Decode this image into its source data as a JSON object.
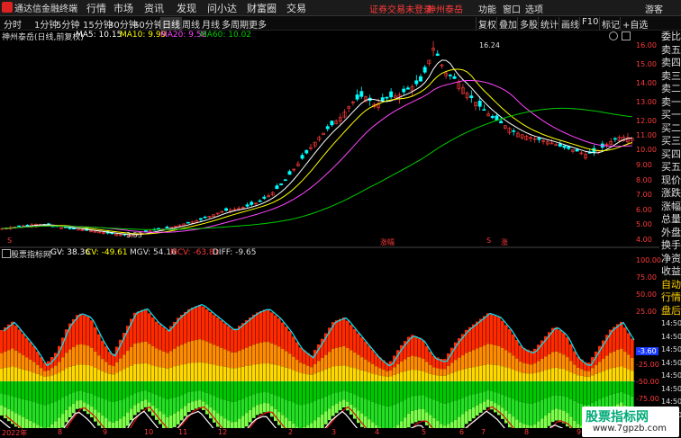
{
  "menubar": {
    "app_name": "通达信金融终端",
    "items": [
      "行情",
      "市场",
      "资讯",
      "发现",
      "问小达",
      "财富圈",
      "交易"
    ],
    "warning": "证券交易未登录",
    "stock": "神州泰岳",
    "right": [
      "功能",
      "窗口",
      "选项",
      "游客"
    ]
  },
  "toolbar": {
    "periods": [
      "分时",
      "1分钟",
      "5分钟",
      "15分钟",
      "30分钟",
      "60分钟",
      "日线",
      "周线",
      "月线",
      "多周期",
      "更多"
    ],
    "active_period": "日线",
    "tools": [
      "复权",
      "叠加",
      "多股",
      "统计",
      "画线",
      "F10",
      "标记",
      "+自选"
    ]
  },
  "infobar": {
    "title": "神州泰岳(日线,前复权)",
    "ma5": "MA5: 10.15",
    "ma10": "MA10: 9.99",
    "ma20": "MA20: 9.58",
    "ma60": "MA60: 10.02"
  },
  "colors": {
    "ma5": "#ffffff",
    "ma10": "#ffff00",
    "ma20": "#ff44ff",
    "ma60": "#00cc00",
    "up": "#ff3b3b",
    "down": "#00ffff",
    "accent": "#ff3b3b"
  },
  "right_panel": [
    "委比",
    "卖五",
    "卖四",
    "卖三",
    "卖二",
    "卖一",
    "买一",
    "买二",
    "买三",
    "买四",
    "买五",
    "现价",
    "涨跌",
    "涨幅",
    "总量",
    "外盘",
    "换手",
    "净资",
    "收益",
    "自动",
    "行情",
    "盘后",
    "14:50",
    "14:50",
    "14:50",
    "14:50",
    "14:50",
    "14:50",
    "14:50",
    "14:50"
  ],
  "price_axis": [
    "16.00",
    "15.00",
    "14.00",
    "13.00",
    "12.00",
    "11.00",
    "10.00",
    "9.00",
    "8.00",
    "7.00",
    "6.00",
    "5.00",
    "4.00"
  ],
  "annotations": {
    "high": "16.24",
    "low": "3.53",
    "event1": "涨幅",
    "event2": "涨"
  },
  "markers": {
    "left": "S",
    "mid": "S"
  },
  "indicator": {
    "name": "股票指标网",
    "gv": "GV: 38.36",
    "cv": "CV: -49.61",
    "mgv": "MGV: 54.16",
    "mcv": "MCV: -63.81",
    "diff": "DIFF: -9.65",
    "axis": [
      "100.00",
      "75.00",
      "50.00",
      "25.00",
      "-25.00",
      "-50.00",
      "-75.00"
    ],
    "current": "-3.60"
  },
  "dates": [
    "2022年",
    "8",
    "9",
    "10",
    "11",
    "12",
    "2",
    "3",
    "4",
    "5",
    "6",
    "7",
    "8",
    "9"
  ],
  "watermark": {
    "line1": "股票指标网",
    "line2": "www.7gpzb.com"
  },
  "chart_data": {
    "type": "candlestick",
    "price_series_approx": [
      4.0,
      4.1,
      4.2,
      4.3,
      4.2,
      4.1,
      4.0,
      3.9,
      3.8,
      3.7,
      3.6,
      3.55,
      3.7,
      3.9,
      4.0,
      4.2,
      4.4,
      4.6,
      4.9,
      5.2,
      5.3,
      5.5,
      5.8,
      6.3,
      7.0,
      8.0,
      9.0,
      10.0,
      10.8,
      11.5,
      12.5,
      13.0,
      12.3,
      12.8,
      13.0,
      13.5,
      14.0,
      16.24,
      14.5,
      14.0,
      13.0,
      12.2,
      11.5,
      11.0,
      10.5,
      10.2,
      10.0,
      9.8,
      9.5,
      9.3,
      9.0,
      9.2,
      9.8,
      10.2,
      10.1
    ],
    "indicator_top_approx": [
      60,
      70,
      55,
      40,
      20,
      35,
      65,
      80,
      75,
      50,
      30,
      55,
      80,
      85,
      70,
      60,
      75,
      85,
      90,
      80,
      70,
      60,
      70,
      80,
      85,
      75,
      60,
      40,
      30,
      50,
      70,
      75,
      60,
      45,
      30,
      20,
      40,
      55,
      50,
      30,
      25,
      45,
      60,
      70,
      80,
      75,
      60,
      40,
      35,
      50,
      65,
      55,
      30,
      20,
      40,
      60,
      70,
      50
    ],
    "indicator_bottom_approx": [
      -40,
      -50,
      -60,
      -70,
      -80,
      -65,
      -45,
      -30,
      -40,
      -55,
      -70,
      -60,
      -40,
      -30,
      -45,
      -60,
      -50,
      -35,
      -30,
      -45,
      -60,
      -70,
      -55,
      -40,
      -35,
      -50,
      -65,
      -80,
      -70,
      -55,
      -40,
      -30,
      -45,
      -60,
      -75,
      -85,
      -70,
      -50,
      -45,
      -60,
      -75,
      -65,
      -50,
      -40,
      -30,
      -40,
      -55,
      -70,
      -75,
      -60,
      -45,
      -50,
      -70,
      -80,
      -60,
      -45,
      -35,
      -50
    ]
  }
}
